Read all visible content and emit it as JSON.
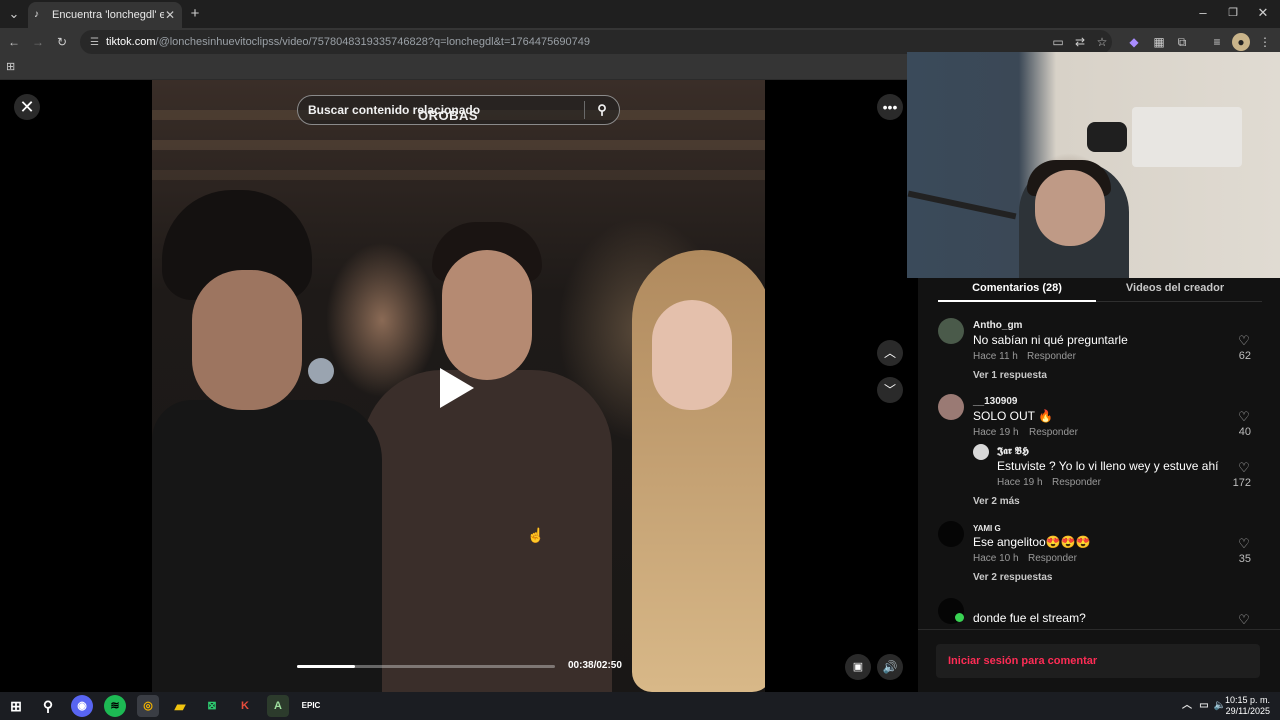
{
  "browser": {
    "tab_title": "Encuentra 'lonchegdl' en TikTok",
    "url_domain": "tiktok.com",
    "url_rest": "/@lonchesinhuevitoclipss/video/7578048319335746828?q=lonchegdl&t=1764475690749"
  },
  "video": {
    "search_placeholder": "Buscar contenido relacionado",
    "watermark": "OROBAS",
    "progress_fraction": 0.226,
    "timecode": "00:38/02:50"
  },
  "panel": {
    "tab_comments": "Comentarios (28)",
    "tab_videos": "Videos del creador",
    "reply_label": "Responder",
    "login_prompt": "Iniciar sesión para comentar",
    "comments": [
      {
        "user": "Antho_gm",
        "text": "No sabían ni qué preguntarle",
        "time": "Hace 11 h",
        "likes": "62",
        "more": "Ver 1 respuesta"
      },
      {
        "user": "__130909",
        "text": "SOLO OUT 🔥",
        "time": "Hace 19 h",
        "likes": "40",
        "more": "Ver 2 más"
      },
      {
        "user": "YAMI G",
        "text": "Ese angelitoo😍😍😍",
        "time": "Hace 10 h",
        "likes": "35",
        "more": "Ver 2 respuestas"
      },
      {
        "user": "",
        "text": "donde fue el stream?",
        "time": "",
        "likes": "",
        "more": ""
      }
    ],
    "nested_reply": {
      "user": "𝕵𝖆𝖗 𝕭𝕳",
      "text": "Estuviste ? Yo lo vi lleno wey y estuve ahí",
      "time": "Hace 19 h",
      "likes": "172"
    }
  },
  "taskbar": {
    "time": "10:15 p. m.",
    "date": "29/11/2025"
  },
  "colors": {
    "accent": "#fe2c55",
    "panel_bg": "#121212",
    "tabbar_bg": "#1f1f1f",
    "toolbar_bg": "#353535"
  }
}
